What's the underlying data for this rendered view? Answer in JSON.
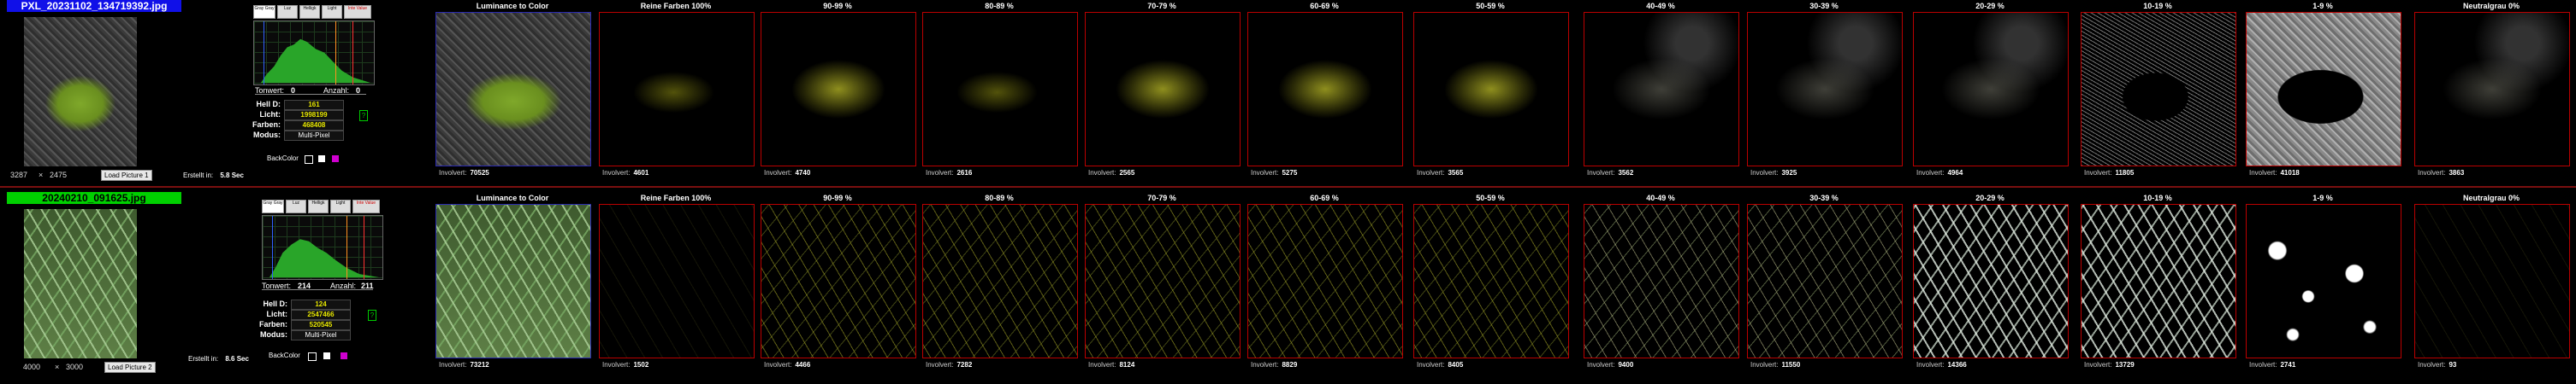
{
  "colors": {
    "blue_title": "#1010e8",
    "green_title": "#00d000",
    "panel_border": "#b00000",
    "histogram_fill": "#29a529",
    "value_yellow": "#e6e600"
  },
  "rows": [
    {
      "file_title": "PXL_20231102_134719392.jpg",
      "width": "3287",
      "height": "2475",
      "load_button": "Load Picture 1",
      "tonwert_label": "Tonwert:",
      "tonwert_value": "0",
      "anzahl_label": "Anzahl:",
      "anzahl_value": "0",
      "hell_d_label": "Hell D:",
      "hell_d_value": "161",
      "licht_label": "Licht:",
      "licht_value": "1998199",
      "farben_label": "Farben:",
      "farben_value": "468408",
      "modus_label": "Modus:",
      "modus_value": "Multi-Pixel",
      "backcolor_label": "BackColor",
      "erstellt_label": "Erstellt in:",
      "erstellt_value": "5.8 Sec",
      "mini_tabs": [
        "Gray Gray",
        "Luz",
        "Helligk",
        "Light",
        "Inte Value"
      ],
      "panels": [
        {
          "title": "Luminance to Color",
          "footer_label": "Involvert:",
          "footer_value": "70525"
        },
        {
          "title": "Reine Farben 100%",
          "footer_label": "Involvert:",
          "footer_value": "4601"
        },
        {
          "title": "90-99 %",
          "footer_label": "Involvert:",
          "footer_value": "4740"
        },
        {
          "title": "80-89 %",
          "footer_label": "Involvert:",
          "footer_value": "2616"
        },
        {
          "title": "70-79 %",
          "footer_label": "Involvert:",
          "footer_value": "2565"
        },
        {
          "title": "60-69 %",
          "footer_label": "Involvert:",
          "footer_value": "5275"
        },
        {
          "title": "50-59 %",
          "footer_label": "Involvert:",
          "footer_value": "3565"
        },
        {
          "title": "40-49 %",
          "footer_label": "Involvert:",
          "footer_value": "3562"
        },
        {
          "title": "30-39 %",
          "footer_label": "Involvert:",
          "footer_value": "3925"
        },
        {
          "title": "20-29 %",
          "footer_label": "Involvert:",
          "footer_value": "4964"
        },
        {
          "title": "10-19 %",
          "footer_label": "Involvert:",
          "footer_value": "11805"
        },
        {
          "title": "1-9 %",
          "footer_label": "Involvert:",
          "footer_value": "41018"
        },
        {
          "title": "Neutralgrau 0%",
          "footer_label": "Involvert:",
          "footer_value": "3863"
        }
      ]
    },
    {
      "file_title": "20240210_091625.jpg",
      "width": "4000",
      "height": "3000",
      "load_button": "Load Picture 2",
      "tonwert_label": "Tonwert:",
      "tonwert_value": "214",
      "anzahl_label": "Anzahl:",
      "anzahl_value": "211",
      "hell_d_label": "Hell D:",
      "hell_d_value": "124",
      "licht_label": "Licht:",
      "licht_value": "2547466",
      "farben_label": "Farben:",
      "farben_value": "520545",
      "modus_label": "Modus:",
      "modus_value": "Multi-Pixel",
      "backcolor_label": "BackColor",
      "erstellt_label": "Erstellt in:",
      "erstellt_value": "8.6 Sec",
      "mini_tabs": [
        "Gray Gray",
        "Luz",
        "Helligk",
        "Light",
        "Inte Value"
      ],
      "panels": [
        {
          "title": "Luminance to Color",
          "footer_label": "Involvert:",
          "footer_value": "73212"
        },
        {
          "title": "Reine Farben 100%",
          "footer_label": "Involvert:",
          "footer_value": "1502"
        },
        {
          "title": "90-99 %",
          "footer_label": "Involvert:",
          "footer_value": "4466"
        },
        {
          "title": "80-89 %",
          "footer_label": "Involvert:",
          "footer_value": "7282"
        },
        {
          "title": "70-79 %",
          "footer_label": "Involvert:",
          "footer_value": "8124"
        },
        {
          "title": "60-69 %",
          "footer_label": "Involvert:",
          "footer_value": "8829"
        },
        {
          "title": "50-59 %",
          "footer_label": "Involvert:",
          "footer_value": "8405"
        },
        {
          "title": "40-49 %",
          "footer_label": "Involvert:",
          "footer_value": "9400"
        },
        {
          "title": "30-39 %",
          "footer_label": "Involvert:",
          "footer_value": "11550"
        },
        {
          "title": "20-29 %",
          "footer_label": "Involvert:",
          "footer_value": "14366"
        },
        {
          "title": "10-19 %",
          "footer_label": "Involvert:",
          "footer_value": "13729"
        },
        {
          "title": "1-9 %",
          "footer_label": "Involvert:",
          "footer_value": "2741"
        },
        {
          "title": "Neutralgrau 0%",
          "footer_label": "Involvert:",
          "footer_value": "93"
        }
      ]
    }
  ]
}
